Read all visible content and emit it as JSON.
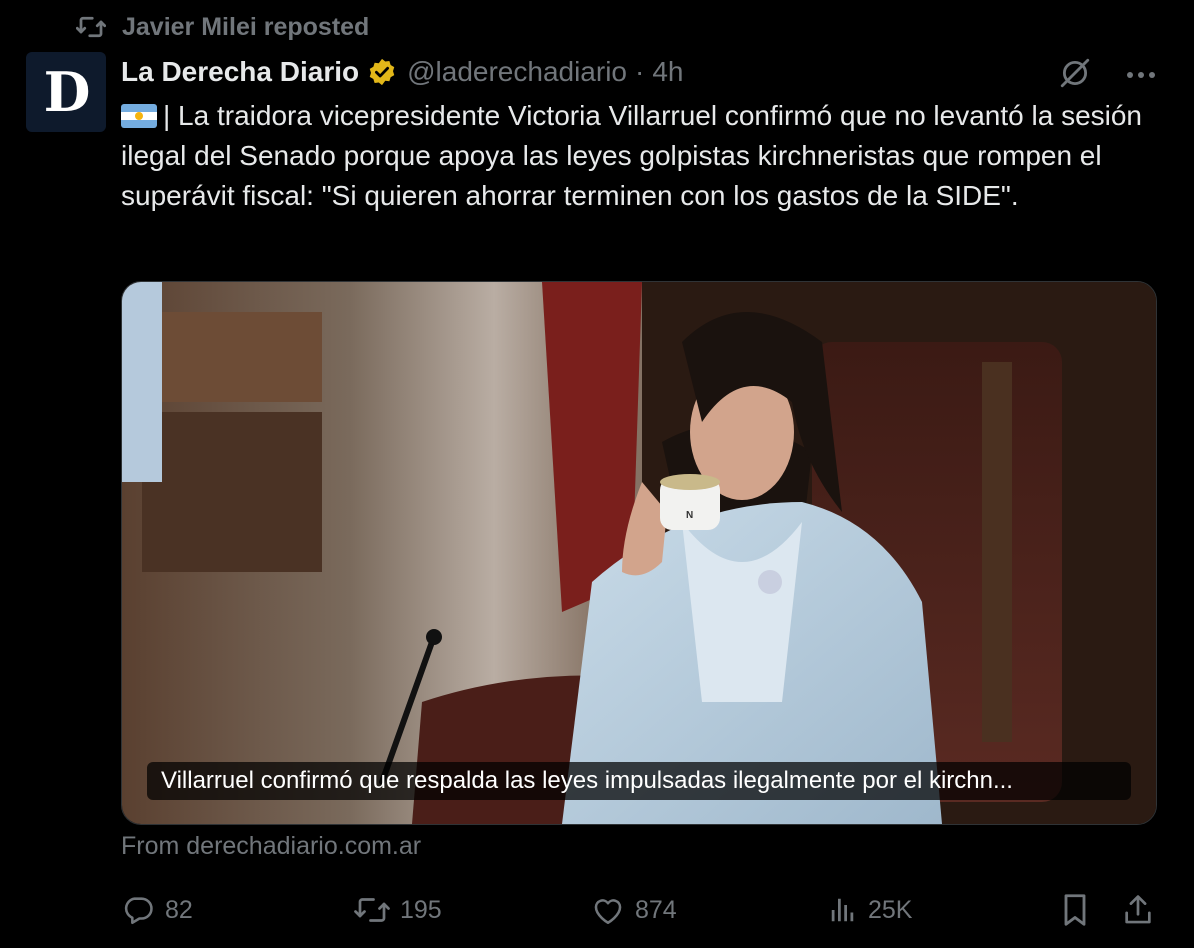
{
  "repost": {
    "text": "Javier Milei reposted",
    "icon": "repost-icon"
  },
  "author": {
    "avatar_letter": "D",
    "name": "La Derecha Diario",
    "verified_icon": "verified-gold-badge-icon",
    "handle": "@laderechadiario",
    "separator": "·",
    "time": "4h"
  },
  "tweet": {
    "flag_icon": "argentina-flag-icon",
    "text": "| La traidora vicepresidente Victoria Villarruel confirmó que no levantó la sesión ilegal del Senado porque apoya las leyes golpistas kirchneristas que rompen el superávit fiscal: \"Si quieren ahorrar terminen con los gastos de la SIDE\"."
  },
  "media": {
    "caption": "Villarruel confirmó que respalda las leyes impulsadas ilegalmente por el kirchn...",
    "cup_letter": "N"
  },
  "source": "From derechadiario.com.ar",
  "actions": {
    "replies": "82",
    "reposts": "195",
    "likes": "874",
    "views": "25K"
  },
  "colors": {
    "background": "#000000",
    "text": "#e7e9ea",
    "secondary": "#71767b",
    "verified": "#e2b719"
  }
}
